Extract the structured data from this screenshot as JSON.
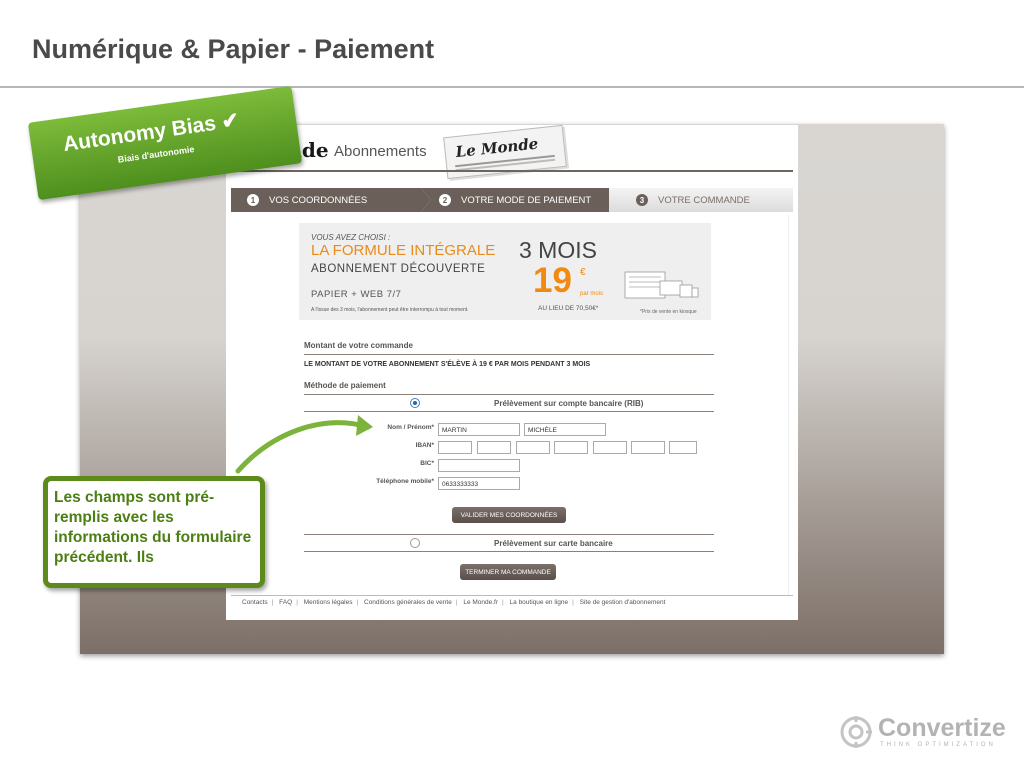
{
  "slide": {
    "title": "Numérique & Papier - Paiement"
  },
  "badge": {
    "title": "Autonomy Bias ✔",
    "subtitle": "Biais d'autonomie"
  },
  "note": {
    "text": "Les champs sont pré-remplis avec les informations du formulaire précédent. Ils"
  },
  "site": {
    "logo_text": "onde",
    "section": "Abonnements",
    "newspaper_title": "Le Monde",
    "steps": [
      {
        "num": "1",
        "label": "VOS COORDONNÉES"
      },
      {
        "num": "2",
        "label": "VOTRE MODE DE PAIEMENT"
      },
      {
        "num": "3",
        "label": "VOTRE COMMANDE"
      }
    ],
    "offer": {
      "chosen": "VOUS AVEZ CHOISI :",
      "formula": "LA FORMULE INTÉGRALE",
      "type": "ABONNEMENT DÉCOUVERTE",
      "media": "PAPIER + WEB 7/7",
      "disclaimer": "A l'issue des 3 mois, l'abonnement peut être interrompu à tout moment.",
      "duration": "3 MOIS",
      "price": "19",
      "currency": "€",
      "per_month": "par mois",
      "instead_of": "AU LIEU DE 70,50€*",
      "kiosk_note": "*Prix de vente en kiosque"
    },
    "order": {
      "amount_title": "Montant de votre commande",
      "amount_text": "LE MONTANT DE VOTRE ABONNEMENT S'ÉLÈVE À 19 € PAR MOIS PENDANT 3 MOIS",
      "method_title": "Méthode de paiement",
      "option_rib": "Prélèvement sur compte bancaire (RIB)",
      "option_card": "Prélèvement sur carte bancaire"
    },
    "form": {
      "name_label": "Nom / Prénom*",
      "last_name": "MARTIN",
      "first_name": "MICHÈLE",
      "iban_label": "IBAN*",
      "bic_label": "BIC*",
      "phone_label": "Téléphone mobile*",
      "phone": "0633333333",
      "validate_button": "VALIDER MES COORDONNÉES",
      "finish_button": "TERMINER MA COMMANDE"
    },
    "footer": [
      "Contacts",
      "FAQ",
      "Mentions légales",
      "Conditions générales de vente",
      "Le Monde.fr",
      "La boutique en ligne",
      "Site de gestion d'abonnement"
    ]
  },
  "brand": {
    "name": "Convertize",
    "tagline": "THINK OPTIMIZATION"
  },
  "colors": {
    "accent_green": "#5c8b1c",
    "orange": "#f08a10",
    "brown": "#6b6059"
  }
}
